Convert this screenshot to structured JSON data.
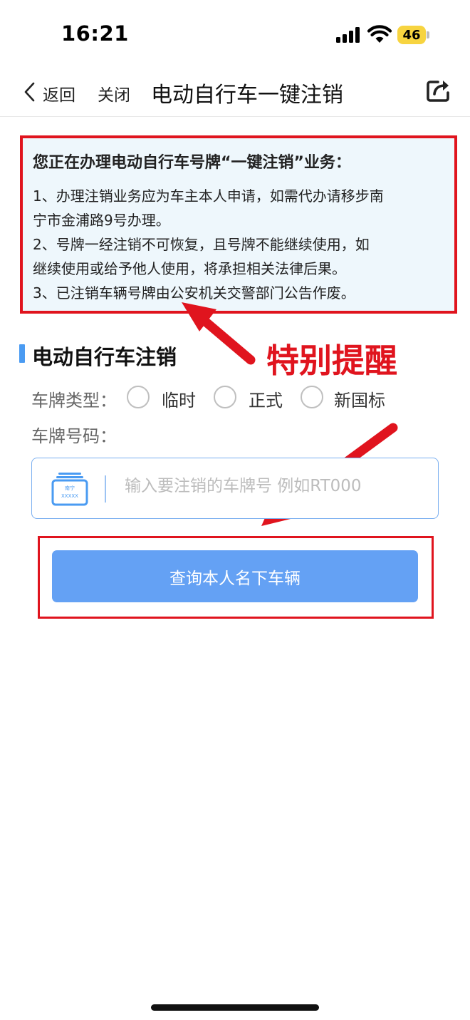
{
  "status_bar": {
    "time": "16:21",
    "battery": "46"
  },
  "nav": {
    "back": "返回",
    "close": "关闭",
    "title": "电动自行车一键注销"
  },
  "notice": {
    "title": "您正在办理电动自行车号牌“一键注销”业务：",
    "lines": [
      "1、办理注销业务应为车主本人申请，如需代办请移步南",
      "宁市金浦路9号办理。",
      "2、号牌一经注销不可恢复，且号牌不能继续使用，如",
      "继续使用或给予他人使用，将承担相关法律后果。",
      "3、已注销车辆号牌由公安机关交警部门公告作废。"
    ]
  },
  "section": {
    "title": "电动自行车注销"
  },
  "annotation": {
    "text": "特别提醒"
  },
  "form": {
    "plate_type_label": "车牌类型：",
    "plate_types": [
      "临时",
      "正式",
      "新国标"
    ],
    "plate_number_label": "车牌号码：",
    "input_placeholder": "输入要注销的车牌号 例如RT000",
    "plate_icon_top": "南宁",
    "plate_icon_bottom": "XXXXX"
  },
  "query_button": {
    "label": "查询本人名下车辆"
  },
  "colors": {
    "accent": "#4a9bf2",
    "button": "#64a1f4",
    "annotation_red": "#e0141e",
    "notice_bg": "#eef7fc"
  }
}
